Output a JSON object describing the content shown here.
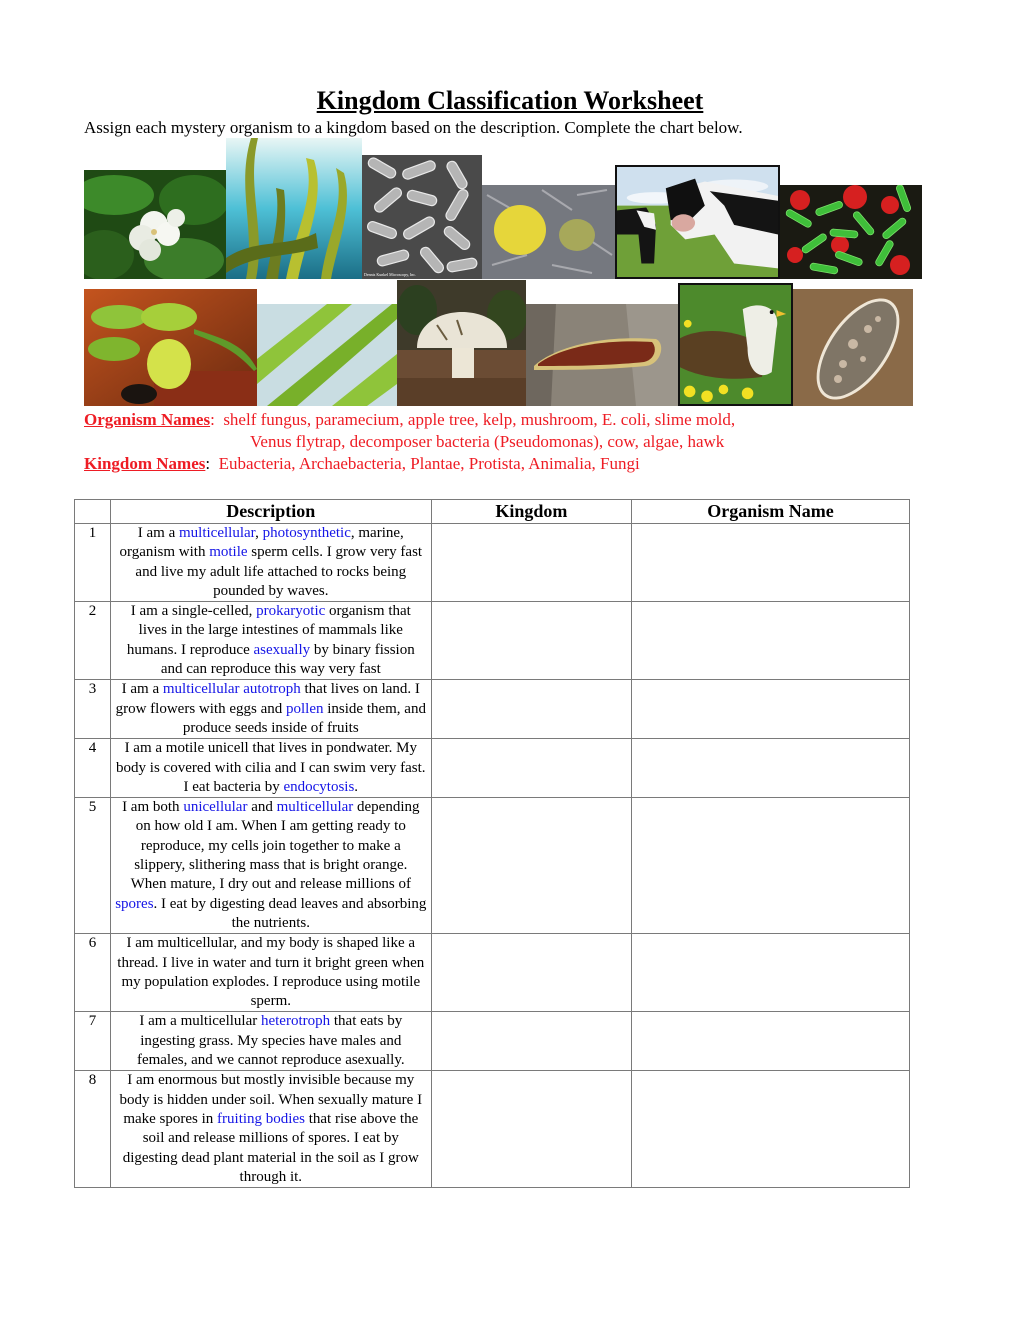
{
  "header": {
    "title": "Kingdom Classification Worksheet",
    "instructions": "Assign each mystery organism to a kingdom based on the description. Complete the chart below."
  },
  "photos": {
    "top_row": [
      {
        "subject": "apple tree blossom"
      },
      {
        "subject": "kelp"
      },
      {
        "subject": "E. coli micrograph"
      },
      {
        "subject": "slime mold"
      },
      {
        "subject": "cow"
      },
      {
        "subject": "decomposer bacteria"
      }
    ],
    "bottom_row": [
      {
        "subject": "Venus flytrap"
      },
      {
        "subject": "filamentous algae"
      },
      {
        "subject": "mushroom"
      },
      {
        "subject": "shelf fungus"
      },
      {
        "subject": "hawk"
      },
      {
        "subject": "paramecium"
      }
    ],
    "ecoli_caption": "Dennis Kunkel Microscopy, Inc."
  },
  "word_bank": {
    "organism_label": "Organism Names",
    "organism_line1": "shelf fungus, paramecium, apple tree, kelp, mushroom, E. coli, slime mold,",
    "organism_line2": "Venus flytrap, decomposer bacteria (Pseudomonas), cow, algae, hawk",
    "kingdom_label": "Kingdom Names",
    "kingdom_list": "Eubacteria, Archaebacteria, Plantae, Protista, Animalia, Fungi",
    "separator": ":",
    "color": "#ee1c24"
  },
  "table": {
    "headers": [
      "",
      "Description",
      "Kingdom",
      "Organism Name"
    ],
    "highlight_color": "#1515e6",
    "rows": [
      {
        "num": "1",
        "segments": [
          {
            "t": "I am a "
          },
          {
            "t": "multicellular",
            "hl": true
          },
          {
            "t": ", "
          },
          {
            "t": "photosynthetic",
            "hl": true
          },
          {
            "t": ", marine, organism with "
          },
          {
            "t": "motile",
            "hl": true
          },
          {
            "t": " sperm cells. I grow very fast and live my adult life attached to rocks being pounded by waves."
          }
        ],
        "kingdom": "",
        "organism": ""
      },
      {
        "num": "2",
        "segments": [
          {
            "t": "I am a single-celled, "
          },
          {
            "t": "prokaryotic",
            "hl": true
          },
          {
            "t": " organism that lives in the large intestines of mammals like humans. I reproduce "
          },
          {
            "t": "asexually",
            "hl": true
          },
          {
            "t": " by binary fission and can reproduce this way very fast"
          }
        ],
        "kingdom": "",
        "organism": ""
      },
      {
        "num": "3",
        "segments": [
          {
            "t": "I am a "
          },
          {
            "t": "multicellular autotroph",
            "hl": true
          },
          {
            "t": " that lives on land. I grow flowers with eggs and "
          },
          {
            "t": "pollen",
            "hl": true
          },
          {
            "t": " inside them, and produce seeds inside of fruits"
          }
        ],
        "kingdom": "",
        "organism": ""
      },
      {
        "num": "4",
        "segments": [
          {
            "t": "I am a motile unicell that lives in pondwater. My body is covered with cilia and I can swim very fast. I eat bacteria by "
          },
          {
            "t": "endocytosis",
            "hl": true
          },
          {
            "t": "."
          }
        ],
        "kingdom": "",
        "organism": ""
      },
      {
        "num": "5",
        "segments": [
          {
            "t": "I am both "
          },
          {
            "t": "unicellular",
            "hl": true
          },
          {
            "t": " and "
          },
          {
            "t": "multicellular",
            "hl": true
          },
          {
            "t": " depending on how old I am. When I am getting ready to reproduce, my cells join together to make a slippery, slithering mass that is bright orange. When mature, I dry out and release millions of "
          },
          {
            "t": "spores",
            "hl": true
          },
          {
            "t": ". I eat by digesting dead leaves and absorbing the nutrients."
          }
        ],
        "kingdom": "",
        "organism": ""
      },
      {
        "num": "6",
        "segments": [
          {
            "t": "I am multicellular, and my body is shaped like a thread. I live in water and turn it bright green when my population explodes. I reproduce using motile sperm."
          }
        ],
        "kingdom": "",
        "organism": ""
      },
      {
        "num": "7",
        "segments": [
          {
            "t": "I am a multicellular "
          },
          {
            "t": "heterotroph",
            "hl": true
          },
          {
            "t": " that eats by ingesting grass. My species have males and females, and we cannot reproduce asexually."
          }
        ],
        "kingdom": "",
        "organism": ""
      },
      {
        "num": "8",
        "segments": [
          {
            "t": "I am enormous but mostly invisible because my body is hidden under soil. When sexually mature I make spores in "
          },
          {
            "t": "fruiting bodies",
            "hl": true
          },
          {
            "t": " that rise above the soil and release millions of spores. I eat by digesting dead plant material in the soil as I grow through it."
          }
        ],
        "kingdom": "",
        "organism": ""
      }
    ]
  }
}
